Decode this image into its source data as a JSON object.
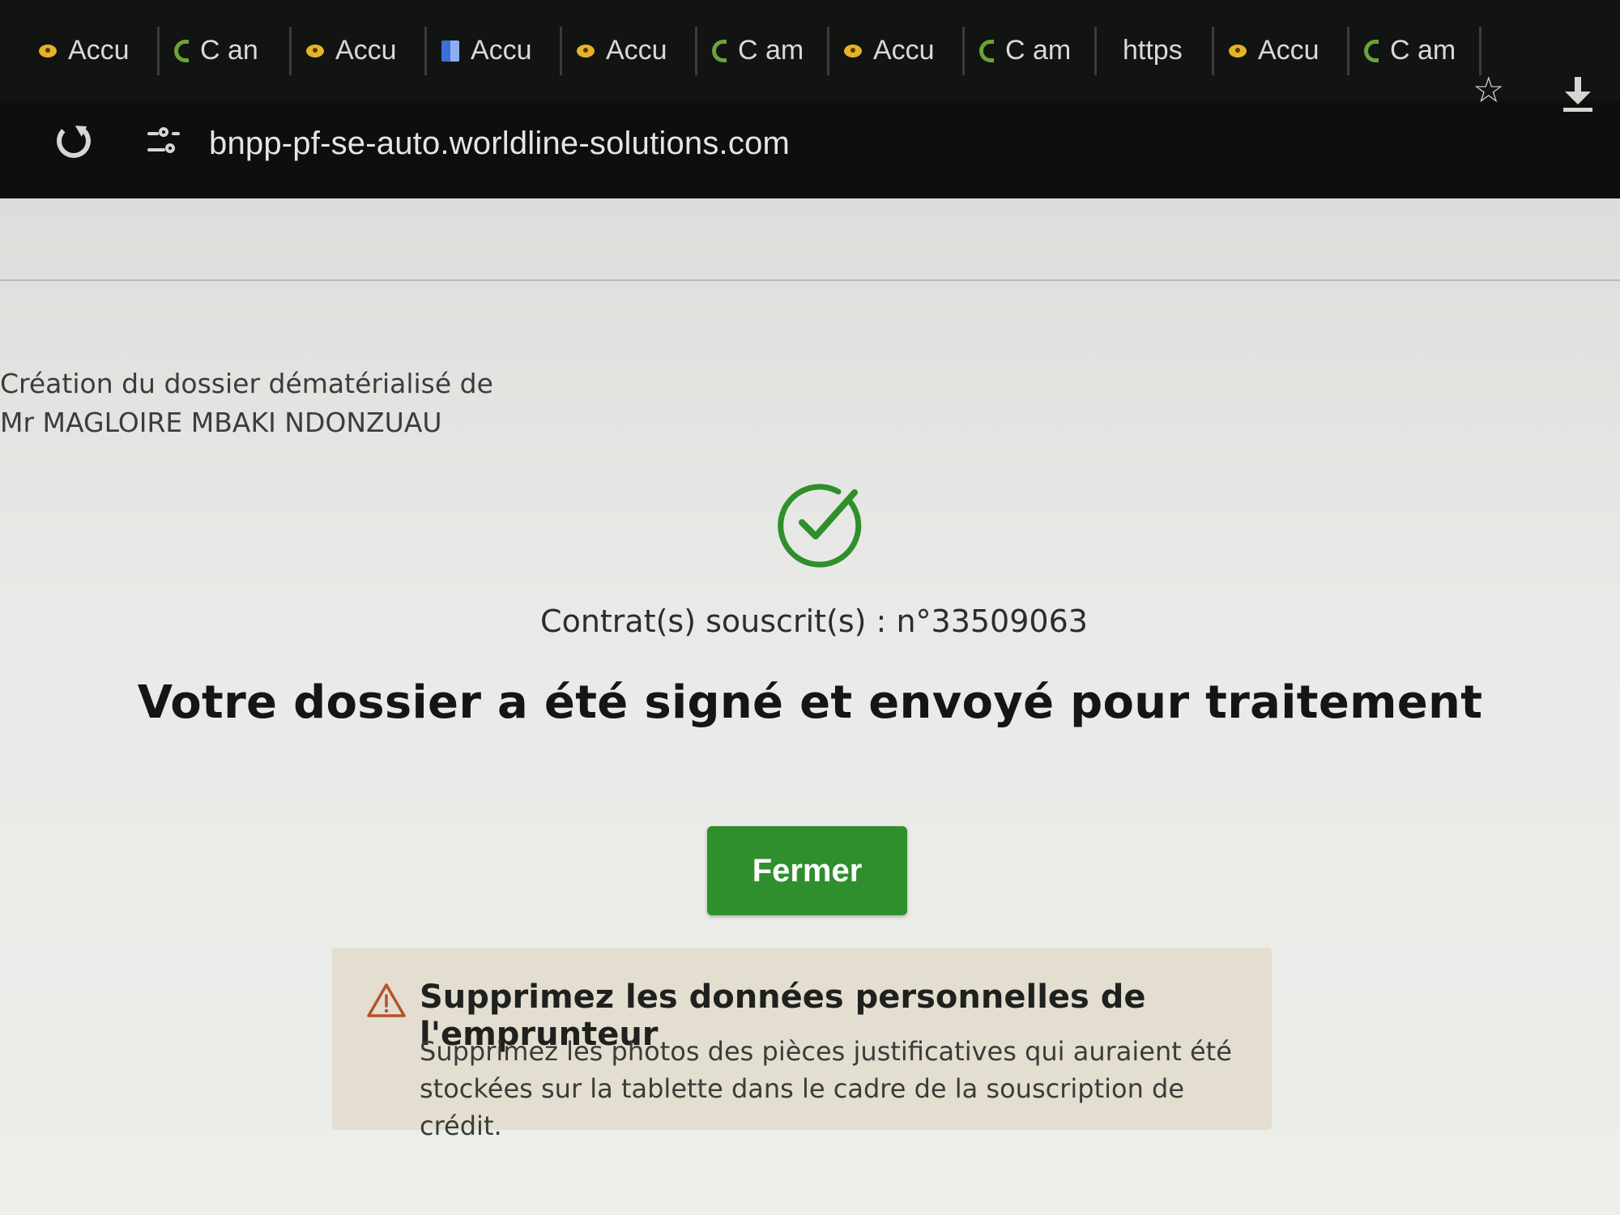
{
  "browser": {
    "tabs": [
      {
        "label": "Accu",
        "icon": "accu-favicon-icon"
      },
      {
        "label": "C an",
        "icon": "cam-favicon-icon"
      },
      {
        "label": "Accu",
        "icon": "accu-favicon-icon"
      },
      {
        "label": "Accu",
        "icon": "grid-favicon-icon"
      },
      {
        "label": "Accu",
        "icon": "accu-favicon-icon"
      },
      {
        "label": "C am",
        "icon": "cam-favicon-icon"
      },
      {
        "label": "Accu",
        "icon": "accu-favicon-icon"
      },
      {
        "label": "C am",
        "icon": "cam-favicon-icon"
      },
      {
        "label": "https",
        "icon": "none"
      },
      {
        "label": "Accu",
        "icon": "accu-favicon-icon"
      },
      {
        "label": "C am",
        "icon": "cam-favicon-icon"
      }
    ],
    "url": "bnpp-pf-se-auto.worldline-solutions.com"
  },
  "page": {
    "dossier_line1": "Création du dossier dématérialisé de",
    "dossier_line2": "Mr MAGLOIRE MBAKI NDONZUAU",
    "contract": "Contrat(s) souscrit(s) : n°33509063",
    "headline": "Votre dossier a été signé et envoyé pour traitement",
    "close_label": "Fermer",
    "warning": {
      "title": "Supprimez les données personnelles de l'emprunteur",
      "text": "Supprimez les photos des pièces justificatives qui auraient été stockées sur la tablette dans le cadre de la souscription de crédit."
    }
  },
  "colors": {
    "accent_green": "#2f8f2c",
    "warning_bg": "#e3ded0",
    "chrome_dark": "#121412"
  }
}
